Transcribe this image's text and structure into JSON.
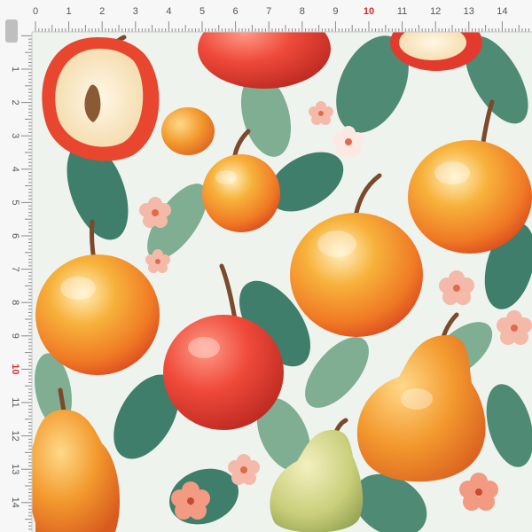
{
  "image": {
    "subject": "watercolor-apple-pear-fabric-print",
    "colors": {
      "background": "#eef3ee",
      "ruler_bg": "#f7f7f7",
      "ruler_tick": "#8a8a8a",
      "ruler_text": "#555555",
      "ruler_accent": "#d42a2a",
      "apple_red": "#e23b2e",
      "apple_orange": "#f39a2e",
      "apple_yellow": "#f7c25a",
      "pear_green": "#c9cf7a",
      "leaf_dark": "#3f7e6a",
      "leaf_light": "#7fae92",
      "blossom": "#f4b9a8"
    }
  },
  "ruler": {
    "top_labels": [
      "0",
      "1",
      "2",
      "3",
      "4",
      "5",
      "6",
      "7",
      "8",
      "9",
      "10",
      "11",
      "12",
      "13",
      "14"
    ],
    "left_labels": [
      "1",
      "2",
      "3",
      "4",
      "5",
      "6",
      "7",
      "8",
      "9",
      "10",
      "11",
      "12",
      "13",
      "14"
    ],
    "accent_label": "10"
  }
}
